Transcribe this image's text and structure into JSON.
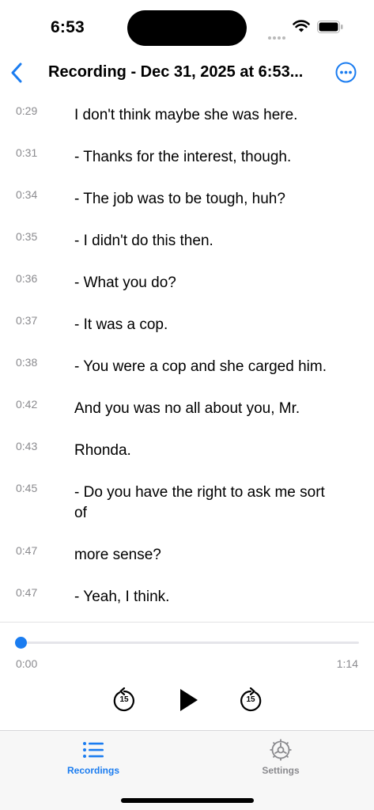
{
  "status_bar": {
    "time": "6:53"
  },
  "nav": {
    "title": "Recording - Dec 31, 2025 at 6:53...",
    "accent_color": "#1a7cf0"
  },
  "transcript": [
    {
      "time": "0:29",
      "text": "I don't think maybe she was here."
    },
    {
      "time": "0:31",
      "text": "- Thanks for the interest, though."
    },
    {
      "time": "0:34",
      "text": "- The job was to be tough, huh?"
    },
    {
      "time": "0:35",
      "text": "- I didn't do this then."
    },
    {
      "time": "0:36",
      "text": "- What you do?"
    },
    {
      "time": "0:37",
      "text": "- It was a cop."
    },
    {
      "time": "0:38",
      "text": "- You were a cop and she carged him."
    },
    {
      "time": "0:42",
      "text": "And you was no all about you, Mr."
    },
    {
      "time": "0:43",
      "text": "Rhonda."
    },
    {
      "time": "0:45",
      "text": "- Do you have the right to ask me sort of"
    },
    {
      "time": "0:47",
      "text": "more sense?"
    },
    {
      "time": "0:47",
      "text": "- Yeah, I think."
    }
  ],
  "player": {
    "current_time": "0:00",
    "total_time": "1:14",
    "progress": 0,
    "skip_back_seconds": "15",
    "skip_forward_seconds": "15"
  },
  "tabs": [
    {
      "label": "Recordings",
      "icon": "list-icon",
      "selected": true
    },
    {
      "label": "Settings",
      "icon": "gear-icon",
      "selected": false
    }
  ]
}
